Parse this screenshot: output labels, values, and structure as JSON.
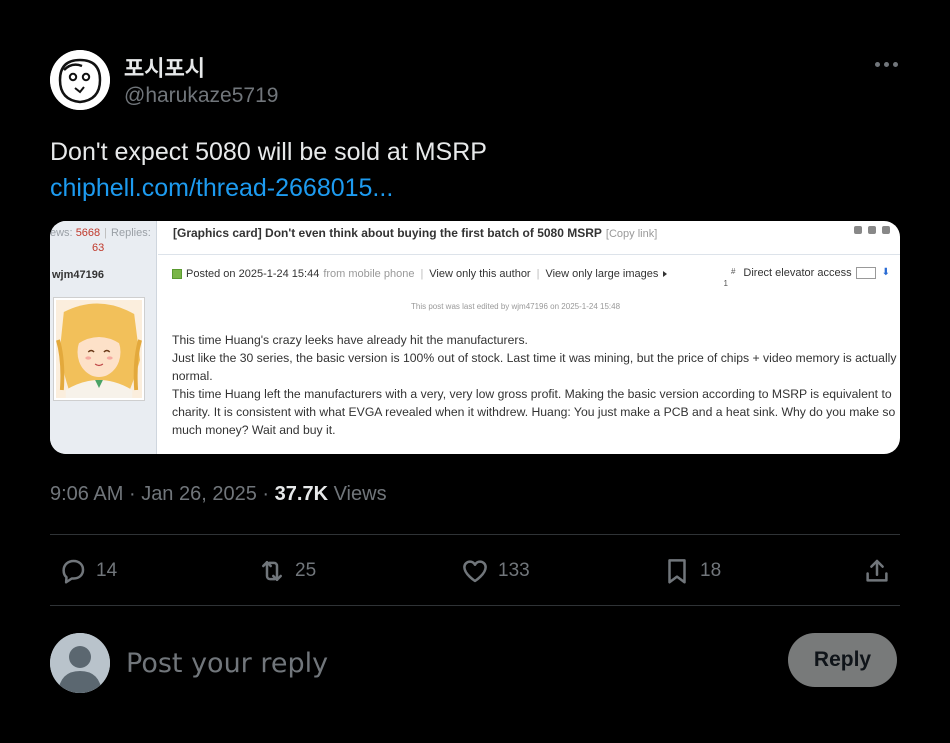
{
  "author": {
    "name": "포시포시",
    "handle": "@harukaze5719"
  },
  "tweet": {
    "text": "Don't expect 5080 will be sold at MSRP",
    "link": "chiphell.com/thread-2668015..."
  },
  "media": {
    "stats_views_label": "ews:",
    "stats_views": "5668",
    "stats_replies_label": "Replies:",
    "stats_replies": "63",
    "username": "wjm47196",
    "title": "[Graphics card] Don't even think about buying the first batch of 5080 MSRP",
    "copy_link": "[Copy link]",
    "posted_on": "Posted on 2025-1-24 15:44",
    "from_mobile": "from mobile phone",
    "only_author": "View only this author",
    "only_large": "View only large images",
    "elevator_num": "1",
    "elevator_hash": "#",
    "elevator_label": "Direct elevator access",
    "edited_note": "This post was last edited by wjm47196 on 2025-1-24 15:48",
    "body": [
      "This time Huang's crazy leeks have already hit the manufacturers.",
      "Just like the 30 series, the basic version is 100% out of stock. Last time it was mining, but the price of chips + video memory is actually normal.",
      "This time Huang left the manufacturers with a very, very low gross profit. Making the basic version according to MSRP is equivalent to charity. It is consistent with what EVGA revealed when it withdrew. Huang: You just make a PCB and a heat sink. Why do you make so much money? Wait and buy it."
    ]
  },
  "meta": {
    "time": "9:06 AM",
    "sep": "·",
    "date": "Jan 26, 2025",
    "views_count": "37.7K",
    "views_label": "Views"
  },
  "actions": {
    "replies": "14",
    "retweets": "25",
    "likes": "133",
    "bookmarks": "18"
  },
  "compose": {
    "placeholder": "Post your reply",
    "button": "Reply"
  },
  "colors": {
    "background": "#000000",
    "link": "#1d9bf0",
    "muted": "#71767b",
    "text": "#e7e9ea",
    "reply_button": "#787a7a"
  }
}
